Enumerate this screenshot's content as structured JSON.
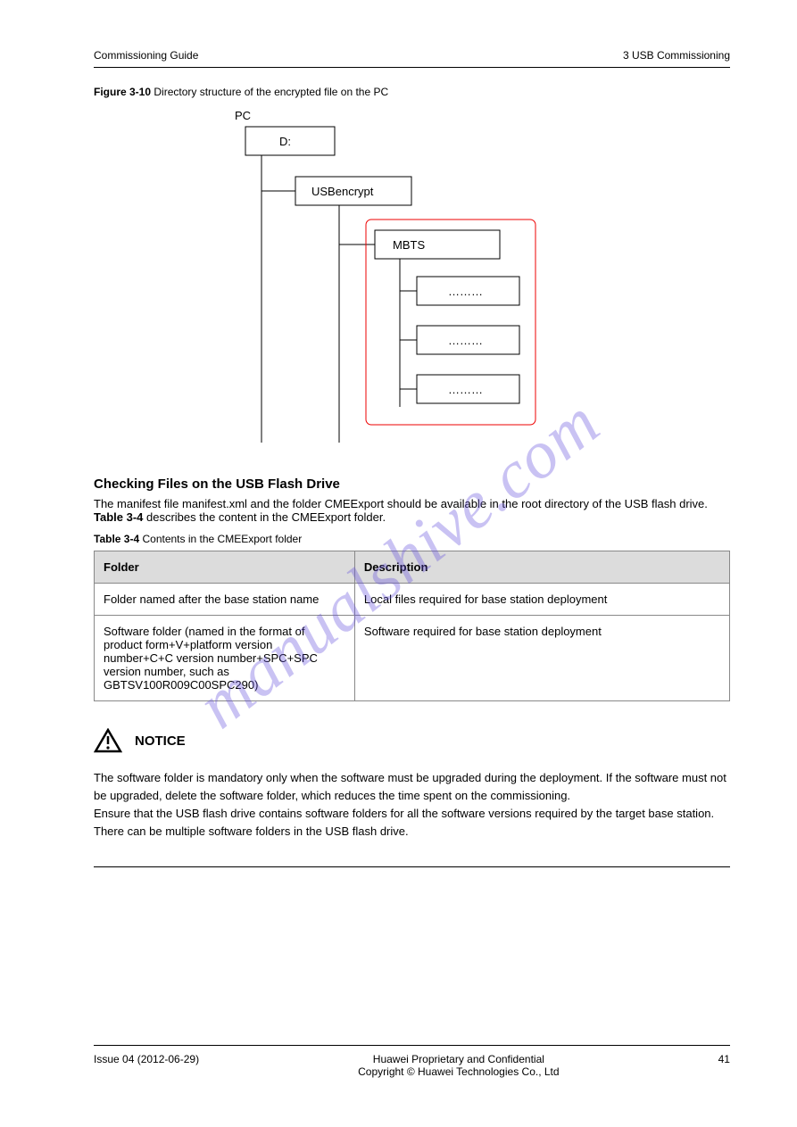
{
  "header": {
    "left": "Commissioning Guide",
    "right": "3 USB Commissioning"
  },
  "fig_caption": {
    "prefix": "Figure 3-10",
    "text": " Directory structure of the encrypted file on the PC"
  },
  "diagram": {
    "pc": "PC",
    "drive": "D:",
    "usb": "USBencrypt",
    "mbts": "MBTS",
    "dots": "………"
  },
  "section": {
    "title": "Checking Files on the USB Flash Drive",
    "text_prefix": "The manifest file manifest.xml and the folder CMEExport should be available in the root directory of the USB flash drive. ",
    "text_link": "Table 3-4",
    "text_suffix": " describes the content in the CMEExport folder."
  },
  "table_caption": {
    "prefix": "Table 3-4",
    "text": " Contents in the CMEExport folder"
  },
  "table": {
    "headers": [
      "Folder",
      "Description"
    ],
    "rows": [
      {
        "folder": "Folder named after the base station name",
        "desc": "Local files required for base station deployment"
      },
      {
        "folder": "Software folder (named in the format of product form+V+platform version number+C+C version number+SPC+SPC version number, such as GBTSV100R009C00SPC290)",
        "desc": "Software required for base station deployment"
      }
    ]
  },
  "notice": {
    "label": "NOTICE",
    "body_lines": [
      "The software folder is mandatory only when the software must be upgraded during the deployment. If the software must not be upgraded, delete the software folder, which reduces the time spent on the commissioning.",
      "Ensure that the USB flash drive contains software folders for all the software versions required by the target base station. There can be multiple software folders in the USB flash drive."
    ]
  },
  "footer": {
    "left": "Issue 04 (2012-06-29)",
    "center": "Huawei Proprietary and Confidential",
    "center2": "Copyright © Huawei Technologies Co., Ltd",
    "right": "41"
  },
  "watermark": "manualshive.com"
}
